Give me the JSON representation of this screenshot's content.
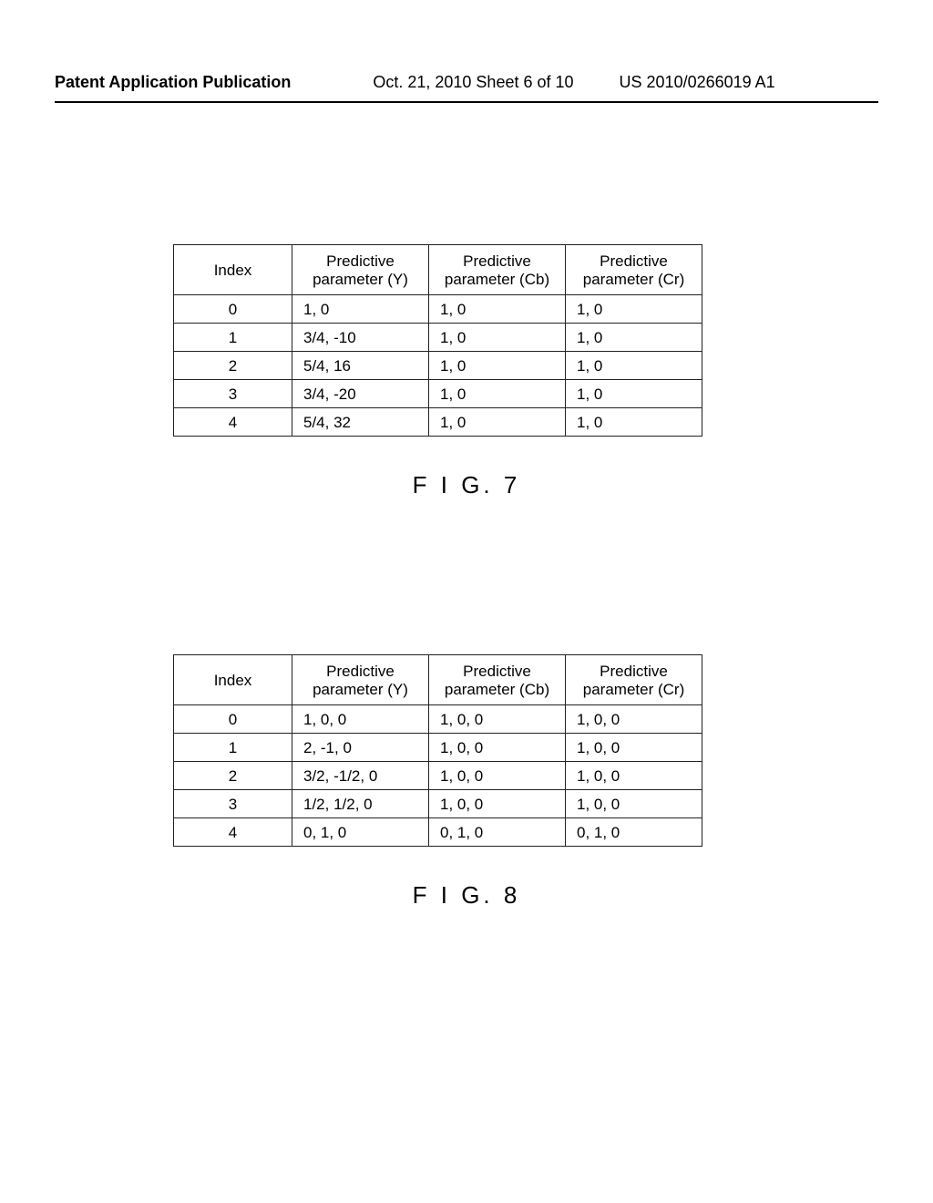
{
  "header": {
    "left": "Patent Application Publication",
    "center": "Oct. 21, 2010  Sheet 6 of 10",
    "right": "US 2010/0266019 A1"
  },
  "fig7": {
    "label": "F I G. 7",
    "columns": [
      "Index",
      "Predictive parameter (Y)",
      "Predictive parameter (Cb)",
      "Predictive parameter (Cr)"
    ],
    "rows": [
      {
        "index": "0",
        "y": "1, 0",
        "cb": "1, 0",
        "cr": "1, 0"
      },
      {
        "index": "1",
        "y": "3/4, -10",
        "cb": "1, 0",
        "cr": "1, 0"
      },
      {
        "index": "2",
        "y": "5/4, 16",
        "cb": "1, 0",
        "cr": "1, 0"
      },
      {
        "index": "3",
        "y": "3/4, -20",
        "cb": "1, 0",
        "cr": "1, 0"
      },
      {
        "index": "4",
        "y": "5/4, 32",
        "cb": "1, 0",
        "cr": "1, 0"
      }
    ]
  },
  "fig8": {
    "label": "F I G. 8",
    "columns": [
      "Index",
      "Predictive parameter (Y)",
      "Predictive parameter (Cb)",
      "Predictive parameter (Cr)"
    ],
    "rows": [
      {
        "index": "0",
        "y": "1, 0, 0",
        "cb": "1, 0, 0",
        "cr": "1, 0, 0"
      },
      {
        "index": "1",
        "y": "2, -1, 0",
        "cb": "1, 0, 0",
        "cr": "1, 0, 0"
      },
      {
        "index": "2",
        "y": "3/2, -1/2, 0",
        "cb": "1, 0, 0",
        "cr": "1, 0, 0"
      },
      {
        "index": "3",
        "y": "1/2, 1/2, 0",
        "cb": "1, 0, 0",
        "cr": "1, 0, 0"
      },
      {
        "index": "4",
        "y": "0, 1, 0",
        "cb": "0, 1, 0",
        "cr": "0, 1, 0"
      }
    ]
  }
}
